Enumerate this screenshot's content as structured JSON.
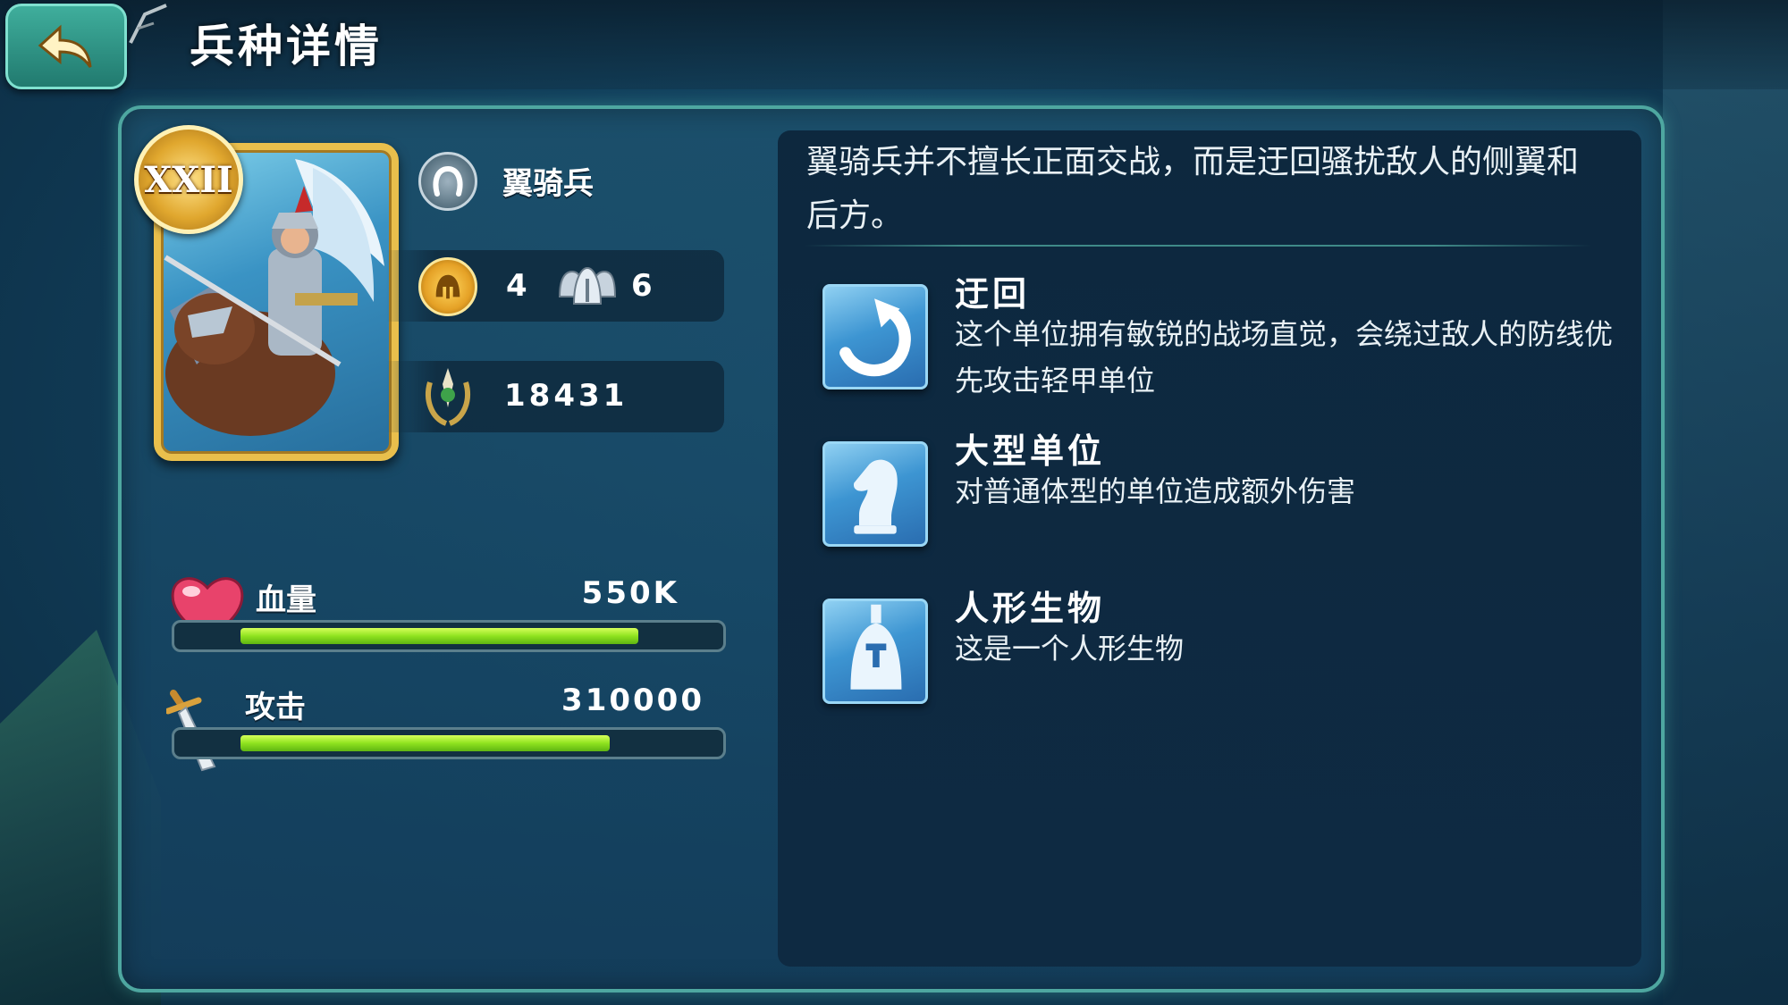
{
  "header": {
    "title": "兵种详情",
    "back_icon": "back-arrow-icon"
  },
  "unit": {
    "rank": "XXII",
    "name": "翼骑兵",
    "type_icon": "horseshoe-icon",
    "count_a": "4",
    "count_b": "6",
    "power": "18431"
  },
  "stats": [
    {
      "label": "血量",
      "value": "550K",
      "fill": 0.84,
      "icon": "heart-icon"
    },
    {
      "label": "攻击",
      "value": "310000",
      "fill": 0.78,
      "icon": "sword-icon"
    }
  ],
  "description": "翼骑兵并不擅长正面交战，而是迂回骚扰敌人的侧翼和后方。",
  "skills": [
    {
      "title": "迂回",
      "desc": "这个单位拥有敏锐的战场直觉，会绕过敌人的防线优先攻击轻甲单位",
      "icon": "circular-arrow-icon"
    },
    {
      "title": "大型单位",
      "desc": "对普通体型的单位造成额外伤害",
      "icon": "chess-knight-icon"
    },
    {
      "title": "人形生物",
      "desc": "这是一个人形生物",
      "icon": "knight-helmet-icon"
    }
  ],
  "colors": {
    "accent": "#4ea7a0",
    "bar": "#8fe31f",
    "gold": "#e9bf4c"
  }
}
